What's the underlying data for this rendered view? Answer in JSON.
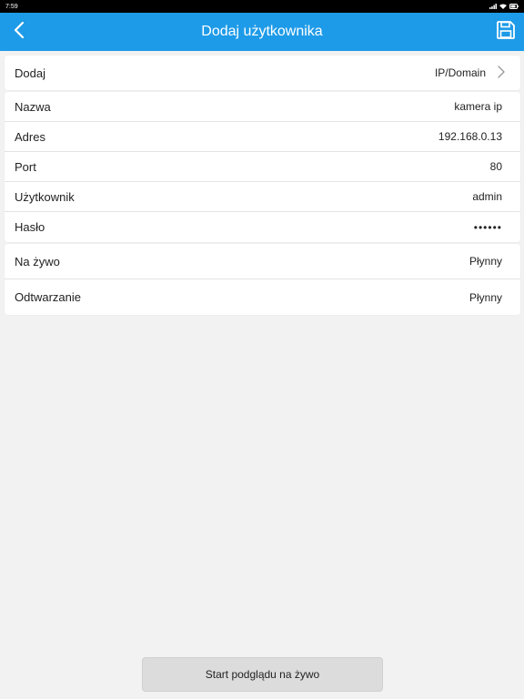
{
  "status_bar": {
    "time": "7:59"
  },
  "header": {
    "title": "Dodaj użytkownika",
    "back_icon": "chevron-left-icon",
    "save_icon": "floppy-disk-icon",
    "background": "#1e9be8"
  },
  "add_row": {
    "label": "Dodaj",
    "value": "IP/Domain"
  },
  "fields": [
    {
      "label": "Nazwa",
      "value": "kamera ip"
    },
    {
      "label": "Adres",
      "value": "192.168.0.13"
    },
    {
      "label": "Port",
      "value": "80"
    },
    {
      "label": "Użytkownik",
      "value": "admin"
    },
    {
      "label": "Hasło",
      "value": "••••••"
    }
  ],
  "stream": [
    {
      "label": "Na żywo",
      "value": "Płynny"
    },
    {
      "label": "Odtwarzanie",
      "value": "Płynny"
    }
  ],
  "footer": {
    "start_button": "Start podglądu na żywo"
  }
}
